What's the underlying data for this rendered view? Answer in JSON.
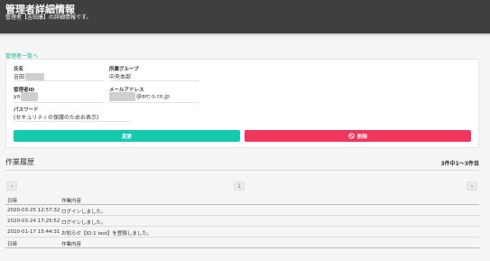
{
  "header": {
    "title": "管理者詳細情報",
    "subtitle": "管理者【吉田康】の詳細情報です。"
  },
  "back_link": "管理者一覧へ",
  "detail": {
    "name": {
      "label": "氏名",
      "value": "吉田"
    },
    "group": {
      "label": "所属グループ",
      "value": "中央本部"
    },
    "admin_id": {
      "label": "管理者ID",
      "value": "ya"
    },
    "email": {
      "label": "メールアドレス",
      "value": "@arc-s.co.jp"
    },
    "password": {
      "label": "パスワード",
      "value": "(セキュリティの保護のためお表示)"
    }
  },
  "buttons": {
    "edit": "変更",
    "delete": "削除",
    "delete_icon": "ban-icon"
  },
  "history": {
    "title": "作業履歴",
    "count": "3件中1～3件目",
    "prev": "‹",
    "page": "1",
    "next": "›",
    "columns": [
      "日時",
      "作業内容"
    ],
    "rows": [
      {
        "datetime": "2020-03-25 12:57:32",
        "action": "ログインしました。"
      },
      {
        "datetime": "2020-03-24 17:25:52",
        "action": "ログインしました。"
      },
      {
        "datetime": "2020-01-17 15:44:31",
        "action": "お知らせ【ID:1 test】を登録しました。"
      }
    ],
    "footer_columns": [
      "日時",
      "作業内容"
    ]
  },
  "colors": {
    "header_bg": "#3f3f3f",
    "accent": "#14c9ad",
    "danger": "#f0365c",
    "link": "#1fb39b"
  }
}
